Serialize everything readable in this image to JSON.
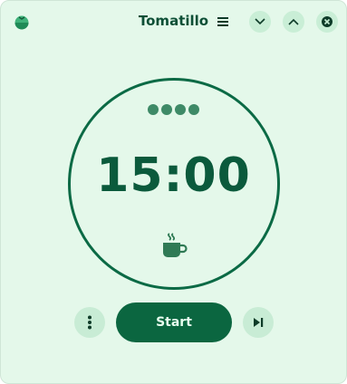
{
  "app": {
    "title": "Tomatillo",
    "icon": "tomatillo-app-icon"
  },
  "headerbar": {
    "menu_icon": "hamburger-menu-icon",
    "minimize_icon": "chevron-down-icon",
    "maximize_icon": "chevron-up-icon",
    "close_icon": "close-icon"
  },
  "timer": {
    "time": "15:00",
    "session_dots": 4,
    "mode_icon": "coffee-cup-icon"
  },
  "controls": {
    "more_icon": "vertical-dots-icon",
    "start_label": "Start",
    "skip_icon": "skip-forward-icon"
  },
  "colors": {
    "background": "#e4f8ea",
    "accent": "#0b6640",
    "ring": "#0b6a45",
    "button_bg": "#c8ecd5"
  }
}
